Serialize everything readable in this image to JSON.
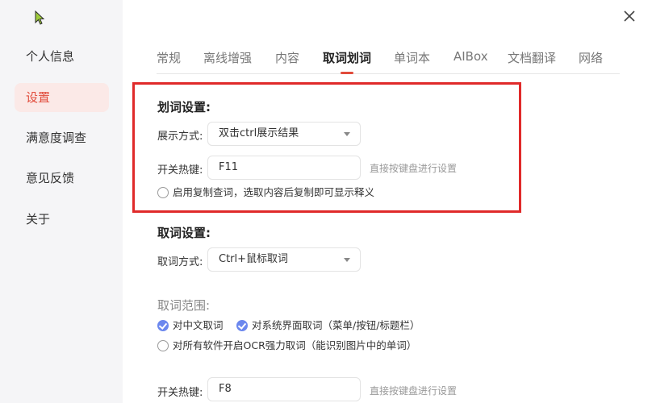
{
  "sidebar": {
    "items": [
      {
        "label": "个人信息"
      },
      {
        "label": "设置",
        "active": true
      },
      {
        "label": "满意度调查"
      },
      {
        "label": "意见反馈"
      },
      {
        "label": "关于"
      }
    ]
  },
  "tabs": [
    {
      "label": "常规"
    },
    {
      "label": "离线增强"
    },
    {
      "label": "内容"
    },
    {
      "label": "取词划词",
      "active": true
    },
    {
      "label": "单词本"
    },
    {
      "label": "AIBox"
    },
    {
      "label": "文档翻译"
    },
    {
      "label": "网络"
    }
  ],
  "huaci": {
    "title": "划词设置:",
    "display_label": "展示方式:",
    "display_value": "双击ctrl展示结果",
    "hotkey_label": "开关热键:",
    "hotkey_value": "F11",
    "hotkey_hint": "直接按键盘进行设置",
    "copy_option": "启用复制查词，选取内容后复制即可显示释义"
  },
  "quci": {
    "title": "取词设置:",
    "method_label": "取词方式:",
    "method_value": "Ctrl+鼠标取词",
    "range_title": "取词范围:",
    "range_options": [
      {
        "label": "对中文取词",
        "checked": true
      },
      {
        "label": "对系统界面取词（菜单/按钮/标题栏）",
        "checked": true
      },
      {
        "label": "对所有软件开启OCR强力取词（能识别图片中的单词）",
        "checked": false
      }
    ],
    "hotkey_label": "开关热键:",
    "hotkey_value": "F8",
    "hotkey_hint": "直接按键盘进行设置"
  },
  "colors": {
    "accent": "#e14b3b",
    "highlight_border": "#e02a2a",
    "checkbox": "#6b87ee",
    "sidebar_bg": "#f5f5f7"
  },
  "icons": {
    "close": "close-icon",
    "cursor": "cursor-icon",
    "dropdown": "caret-down-icon"
  }
}
